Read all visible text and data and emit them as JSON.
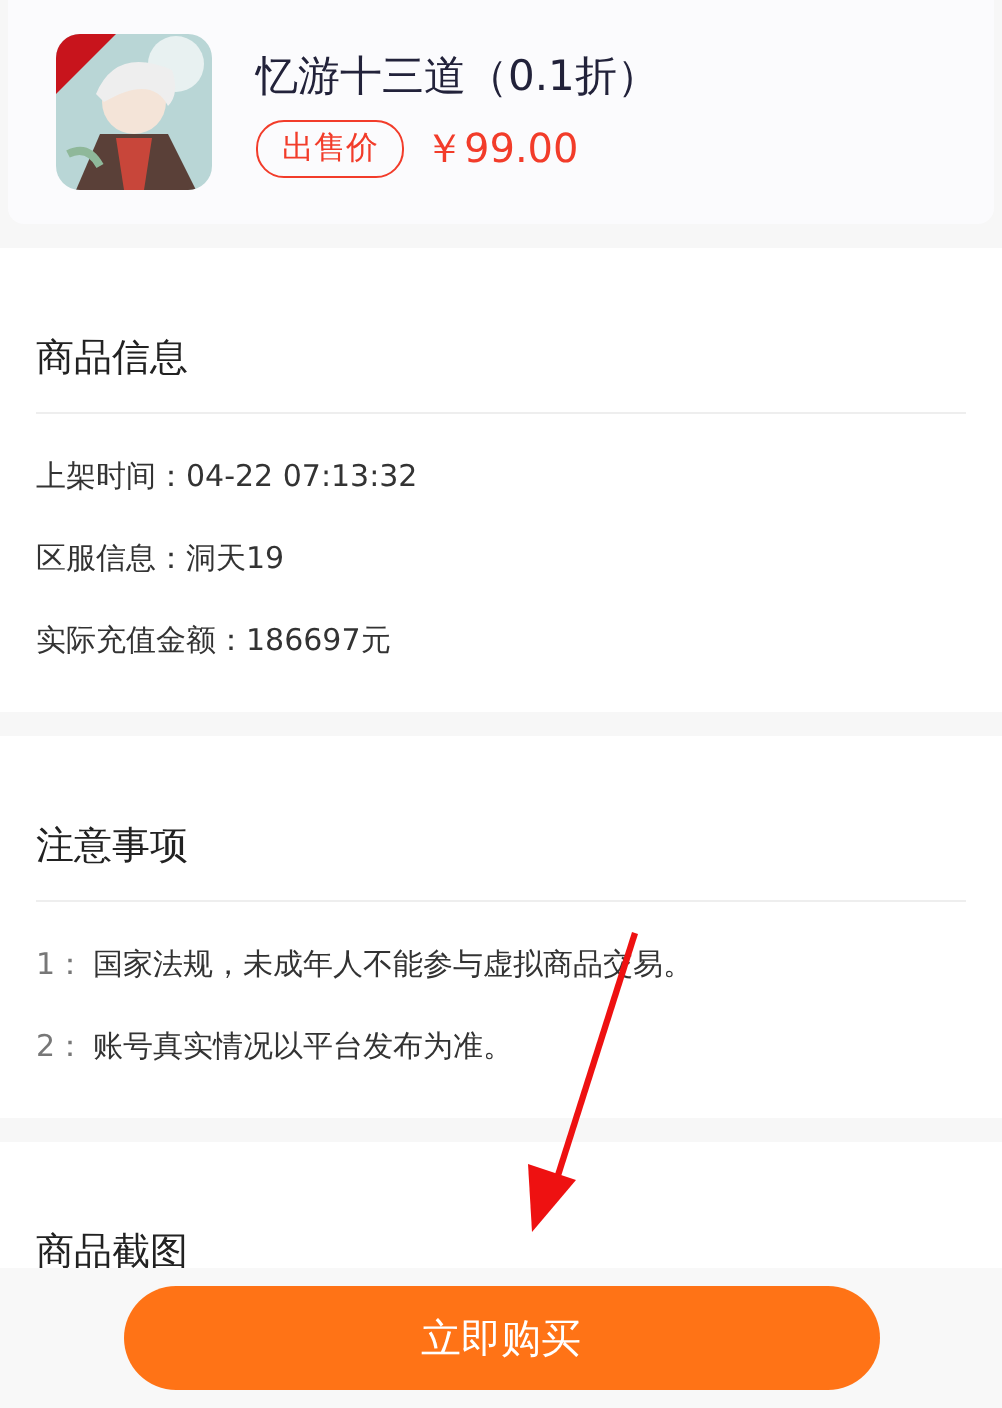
{
  "product": {
    "name": "忆游十三道（0.1折）",
    "price_tag": "出售价",
    "price": "￥99.00"
  },
  "sections": [
    {
      "title": "商品信息",
      "kind": "info",
      "rows": [
        {
          "text": "上架时间：04-22 07:13:32"
        },
        {
          "text": "区服信息：洞天19"
        },
        {
          "text": "实际充值金额：186697元"
        }
      ]
    },
    {
      "title": "注意事项",
      "kind": "notes",
      "rows": [
        {
          "number": "1：",
          "text": "国家法规，未成年人不能参与虚拟商品交易。"
        },
        {
          "number": "2：",
          "text": "账号真实情况以平台发布为准。"
        }
      ]
    },
    {
      "title": "商品截图"
    }
  ],
  "buy_button": {
    "label": "立即购买"
  }
}
